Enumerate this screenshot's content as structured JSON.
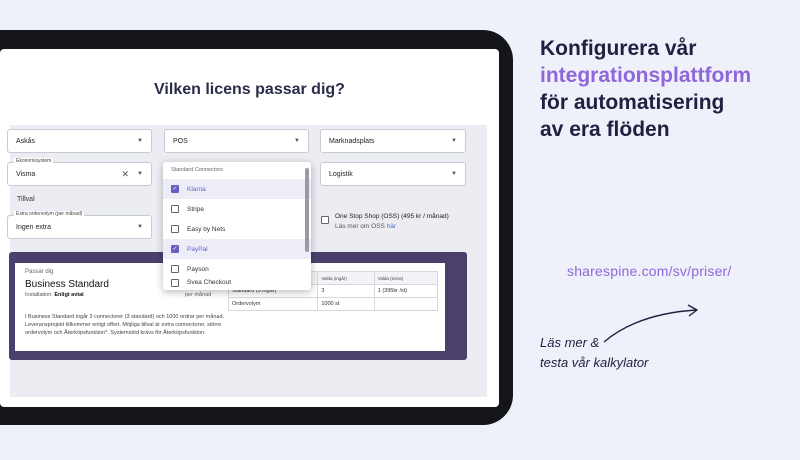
{
  "page_title": "Vilken licens passar dig?",
  "selects": {
    "askas": {
      "value": "Askås"
    },
    "pos": {
      "value": "POS"
    },
    "marknadsplats": {
      "value": "Marknadsplats"
    },
    "ekonomisystem": {
      "label": "Ekonomisystem",
      "value": "Visma"
    },
    "logistik": {
      "value": "Logistik"
    },
    "extra_ordervolym": {
      "label": "Extra ordervolym (per månad)",
      "value": "Ingen extra"
    }
  },
  "tillval_label": "Tillval",
  "oss": {
    "label": "One Stop Shop (OSS) (495 kr / månad)",
    "sub": "Läs mer om OSS",
    "link": "här"
  },
  "dropdown": {
    "header": "Standard Connectors",
    "items": [
      {
        "label": "Klarna",
        "checked": true
      },
      {
        "label": "Stripe",
        "checked": false
      },
      {
        "label": "Easy by Nets",
        "checked": false
      },
      {
        "label": "PayPal",
        "checked": true
      },
      {
        "label": "Payson",
        "checked": false
      },
      {
        "label": "Svea Checkout",
        "checked": false
      }
    ]
  },
  "summary": {
    "passar": "Passar dig",
    "plan": "Business Standard",
    "installation_label": "Installation:",
    "installation_value": "Enligt avtal",
    "per_manad": "per månad",
    "description": "I Business Standard ingår 3 connectorer (3 standard) och 1000 ordrar per månad. Leveransprojekt tillkommer enligt offert. Möjliga tillval är extra connectorer, större ordervolym och Återköpsfunktion*. Systemstöd krävs för Återköpsfunktion.",
    "table": {
      "headers": [
        "",
        "Valda (ingår)",
        "Valda (extra)"
      ],
      "rows": [
        [
          "Standard (3 ingår)",
          "3",
          "1 (395kr /st)"
        ],
        [
          "Ordervolym",
          "1000 st",
          ""
        ]
      ]
    }
  },
  "marketing": {
    "line1": "Konfigurera vår",
    "line2": "integrationsplattform",
    "line3": "för automatisering",
    "line4": "av era flöden",
    "url": "sharespine.com/sv/priser/",
    "cta_line1": "Läs mer &",
    "cta_line2": "testa vår kalkylator"
  },
  "colors": {
    "accent": "#8f67d9",
    "dark": "#1f2140",
    "summary_bg": "#4b3f6e"
  }
}
